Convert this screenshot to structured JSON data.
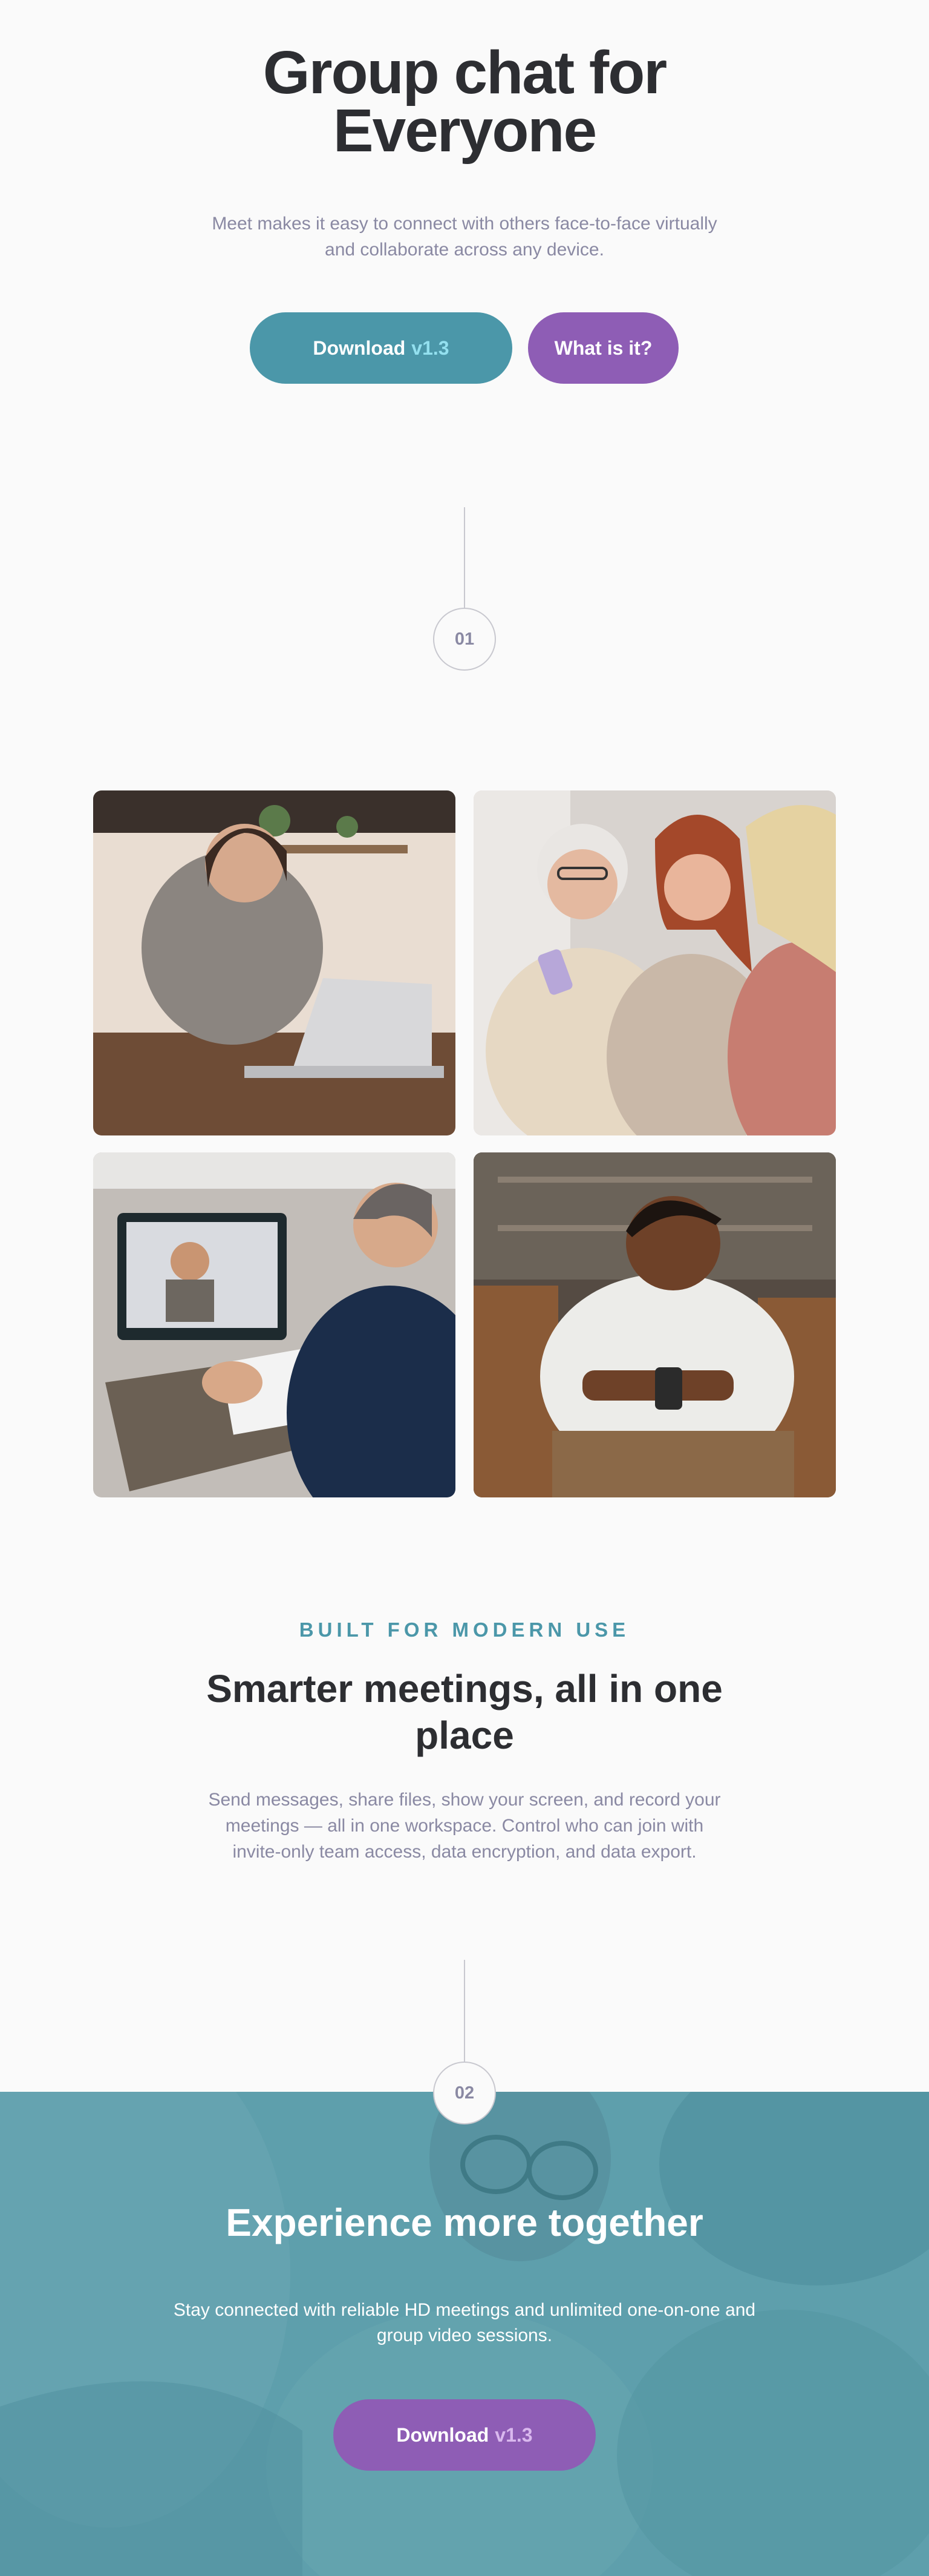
{
  "hero": {
    "title_line1": "Group chat for",
    "title_line2": "Everyone",
    "subtitle_line1": "Meet makes it easy to connect with others face-to-face virtually",
    "subtitle_line2": "and collaborate across any device.",
    "download_label": "Download",
    "download_version": "v1.3",
    "what_label": "What is it?"
  },
  "steps": {
    "step1": "01",
    "step2": "02"
  },
  "gallery": {
    "icons": [
      "woman-laptop-photo",
      "women-phone-photo",
      "video-call-photo",
      "man-phone-photo"
    ]
  },
  "features": {
    "eyebrow": "BUILT FOR MODERN USE",
    "title_line1": "Smarter meetings, all in one",
    "title_line2": "place",
    "body_line1": "Send messages, share files, show your screen, and record your",
    "body_line2": "meetings — all in one workspace. Control who can join with",
    "body_line3": "invite-only team access, data encryption, and data export."
  },
  "cta": {
    "title": "Experience more together",
    "body_line1": "Stay connected with reliable HD meetings and unlimited one-on-one and",
    "body_line2": "group video sessions.",
    "download_label": "Download",
    "download_version": "v1.3"
  },
  "colors": {
    "background": "#fafafa",
    "teal": "#4b97a9",
    "purple": "#8e5db5",
    "heading": "#2d2e32",
    "muted": "#8a89a3"
  }
}
